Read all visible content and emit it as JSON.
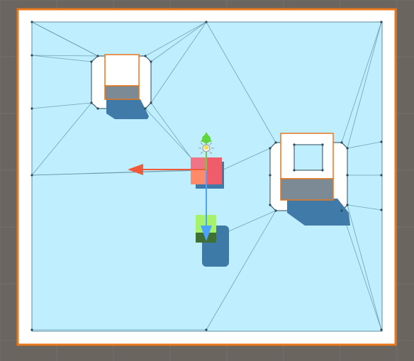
{
  "scene": {
    "background_color": "#6b6560",
    "grid_line_color": "#8a8580",
    "selection_outline_color": "#e8771c",
    "floor_white_color": "#ffffff",
    "navmesh_color": "#bfeefe",
    "navmesh_edge_color": "#5f8ea0",
    "navmesh_vertex_color": "#2a4a5a",
    "obstacle_top_color": "#ffffff",
    "obstacle_side_color": "#7b8a95",
    "obstacle_shadow_color": "#3f7aa8",
    "agent_cube_color": "#ef5d6a",
    "agent_cube_light_color": "#ff8a6a",
    "marker_top_color": "#a6f26a",
    "marker_bottom_color": "#3e7036",
    "marker_shadow_color": "#3e7aa8"
  },
  "gizmo": {
    "x_axis_color": "#f05a3a",
    "y_axis_color": "#5fd83a",
    "z_axis_color": "#4aa3ff",
    "center_color": "#f2e04a",
    "icons": [
      "arrow-x-icon",
      "arrow-y-icon",
      "arrow-z-icon",
      "sun-light-icon"
    ]
  }
}
